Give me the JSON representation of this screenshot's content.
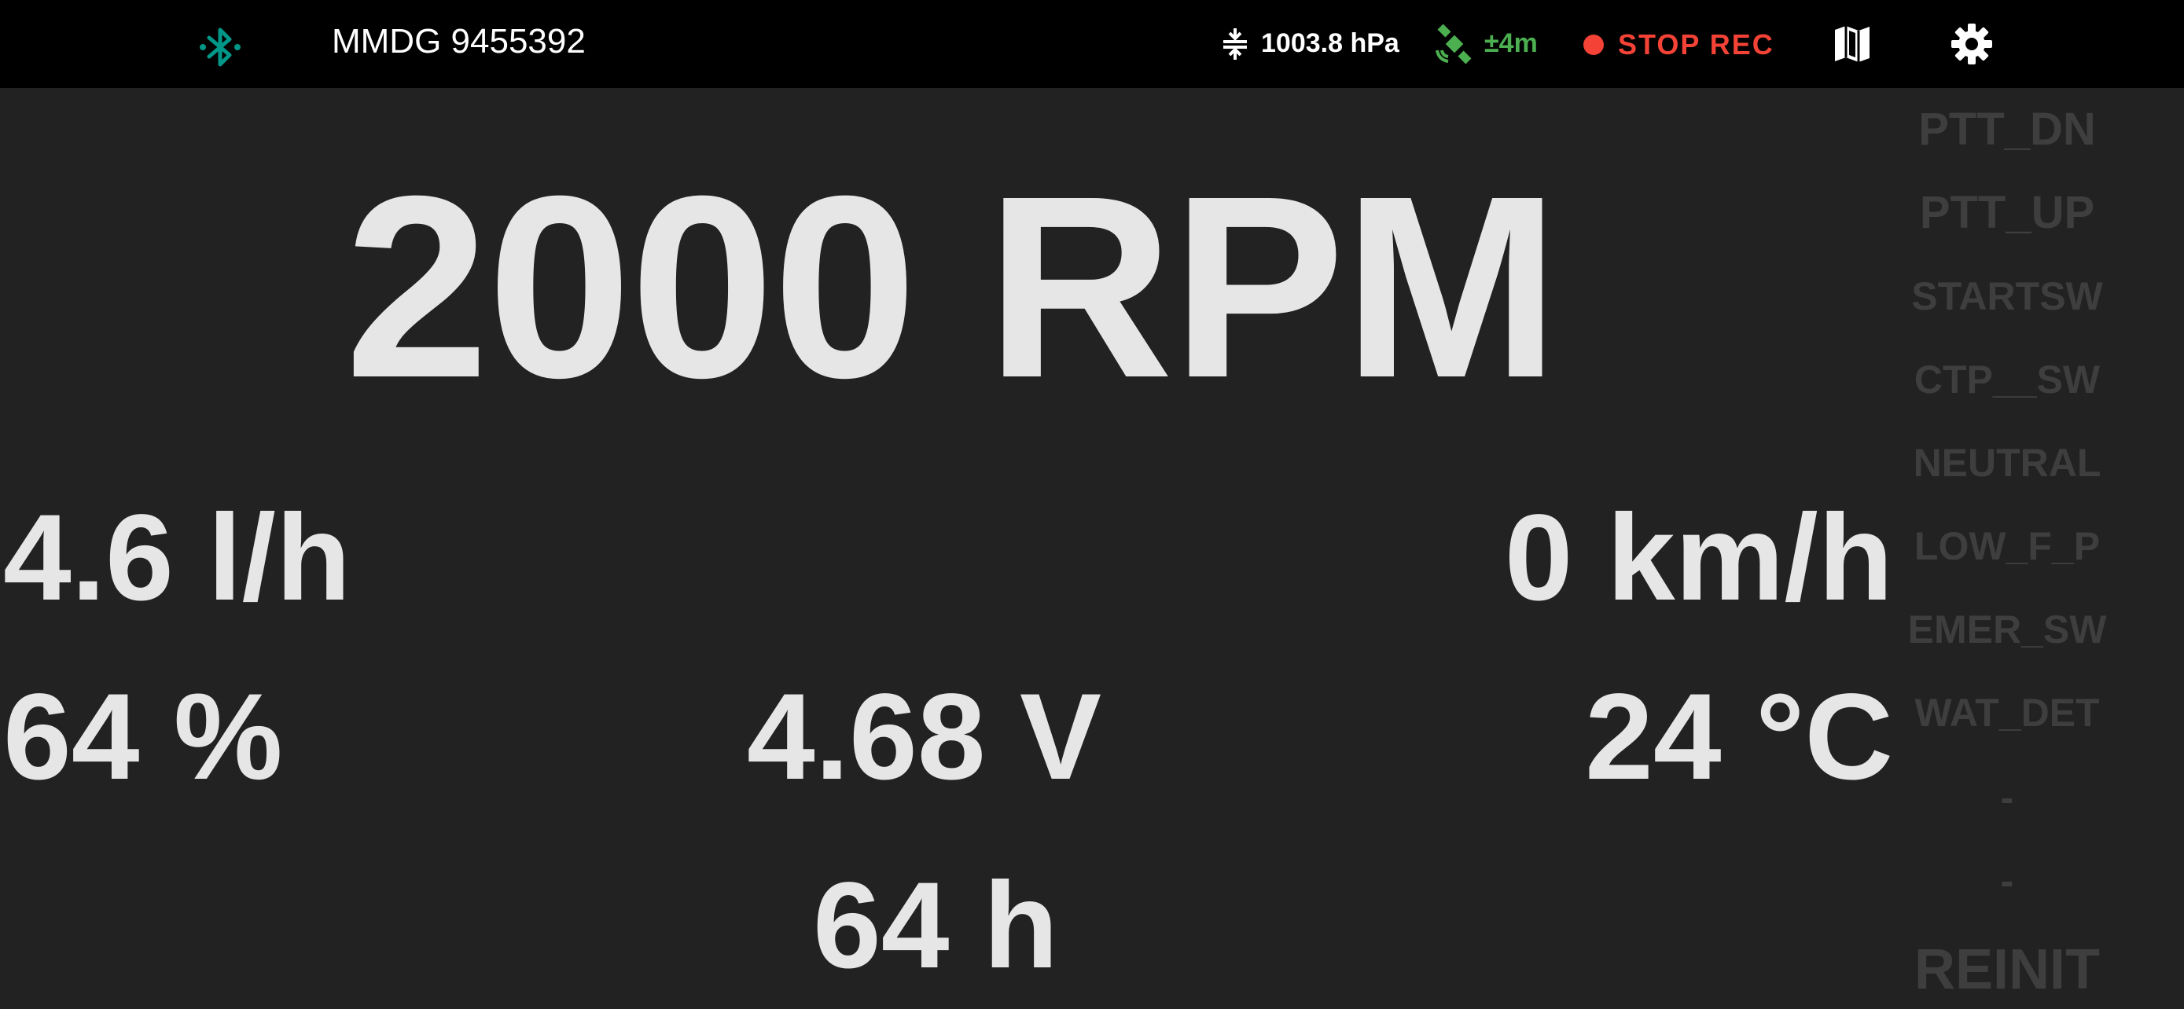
{
  "topbar": {
    "device_name": "MMDG 9455392",
    "pressure": "1003.8 hPa",
    "gps_accuracy": "±4m",
    "record_label": "STOP REC",
    "icons": {
      "bluetooth": "bluetooth-icon",
      "pressure": "pressure-icon",
      "gps": "satellite-icon",
      "record": "record-dot-icon",
      "map": "map-icon",
      "settings": "gear-icon"
    }
  },
  "metrics": {
    "rpm": "2000 RPM",
    "fuel_rate": "4.6 l/h",
    "speed": "0 km/h",
    "tank_level": "64 %",
    "voltage": "4.68 V",
    "temperature": "24 °C",
    "engine_hours": "64 h"
  },
  "side_buttons": [
    {
      "label": "PTT_DN"
    },
    {
      "label": "PTT_UP"
    },
    {
      "label": "STARTSW"
    },
    {
      "label": "CTP__SW"
    },
    {
      "label": "NEUTRAL"
    },
    {
      "label": "LOW_F_P"
    },
    {
      "label": "EMER_SW"
    },
    {
      "label": "WAT_DET"
    },
    {
      "label": "-"
    },
    {
      "label": "-"
    },
    {
      "label": "REINIT"
    }
  ],
  "colors": {
    "background": "#222222",
    "topbar": "#000000",
    "bluetooth": "#009688",
    "gps": "#4caf50",
    "record": "#f44336",
    "metric_text": "#e6e6e6",
    "side_text": "#3e3e3e"
  }
}
